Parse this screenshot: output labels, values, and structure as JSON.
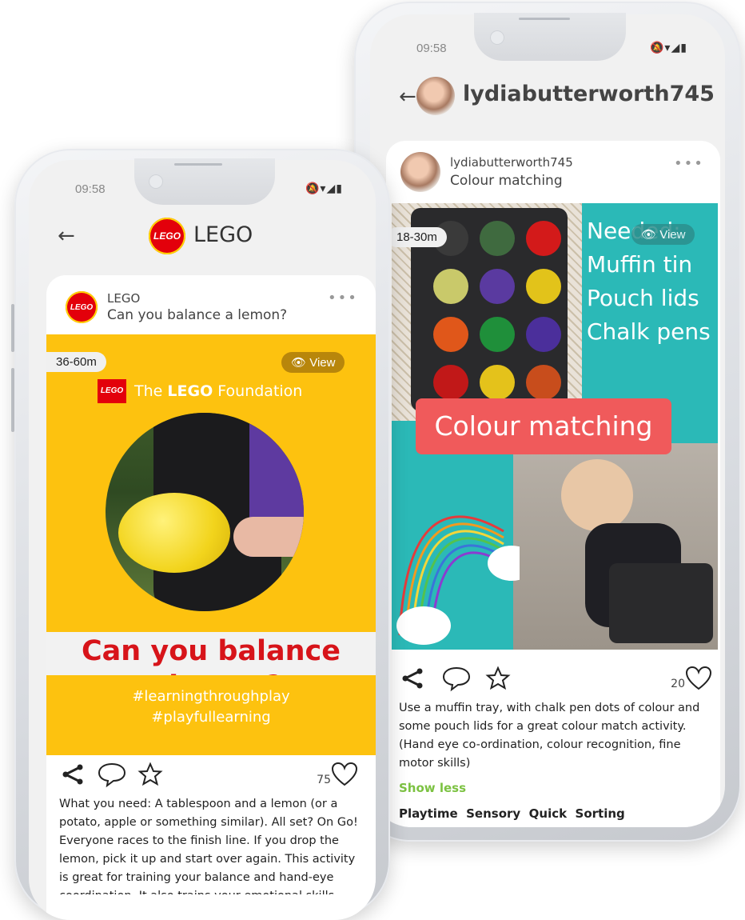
{
  "left_phone": {
    "status_time": "09:58",
    "status_icons": "🔕▾◢▮",
    "header": {
      "title": "LEGO",
      "logo_text": "LEGO"
    },
    "post": {
      "author": "LEGO",
      "title": "Can you balance a lemon?",
      "more": "•••",
      "age_badge": "36-60m",
      "view_label": "View",
      "foundation_logo": "LEGO",
      "foundation_text_1": "The ",
      "foundation_text_2": "LEGO",
      "foundation_text_3": " Foundation",
      "headline_line1": "Can you balance",
      "headline_a": "a ",
      "headline_lemon": "lemon",
      "headline_q": "?",
      "hashtag1": "#learningthroughplay",
      "hashtag2": "#playfullearning",
      "like_count": "75",
      "description": "What you need: A tablespoon and a lemon (or a potato, apple or something similar). All set? On Go! Everyone races to the finish line. If you drop the lemon, pick it up and start over again. This activity is great for training your balance and hand-eye coordination. It also trains your emotional skills."
    }
  },
  "right_phone": {
    "status_time": "09:58",
    "status_icons": "🔕▾◢▮",
    "header": {
      "title": "lydiabutterworth745"
    },
    "post": {
      "author": "lydiabutterworth745",
      "title": "Colour matching",
      "more": "•••",
      "age_badge": "18-30m",
      "view_label": "View",
      "needed_lines": [
        "Needed:",
        "Muffin tin",
        "Pouch lids",
        "Chalk pens"
      ],
      "banner": "Colour matching",
      "like_count": "20",
      "description": "Use a muffin tray, with chalk pen dots of colour and some pouch lids for a great colour match activity. (Hand eye co-ordination, colour recognition, fine motor skills)",
      "show_less": "Show less",
      "tags": "Playtime  Sensory  Quick  Sorting"
    }
  },
  "colors": {
    "lego_red": "#e3000b",
    "lego_yellow": "#fdc20f",
    "teal": "#2bb9b7",
    "coral": "#f05a5b",
    "green_link": "#7cc242"
  }
}
